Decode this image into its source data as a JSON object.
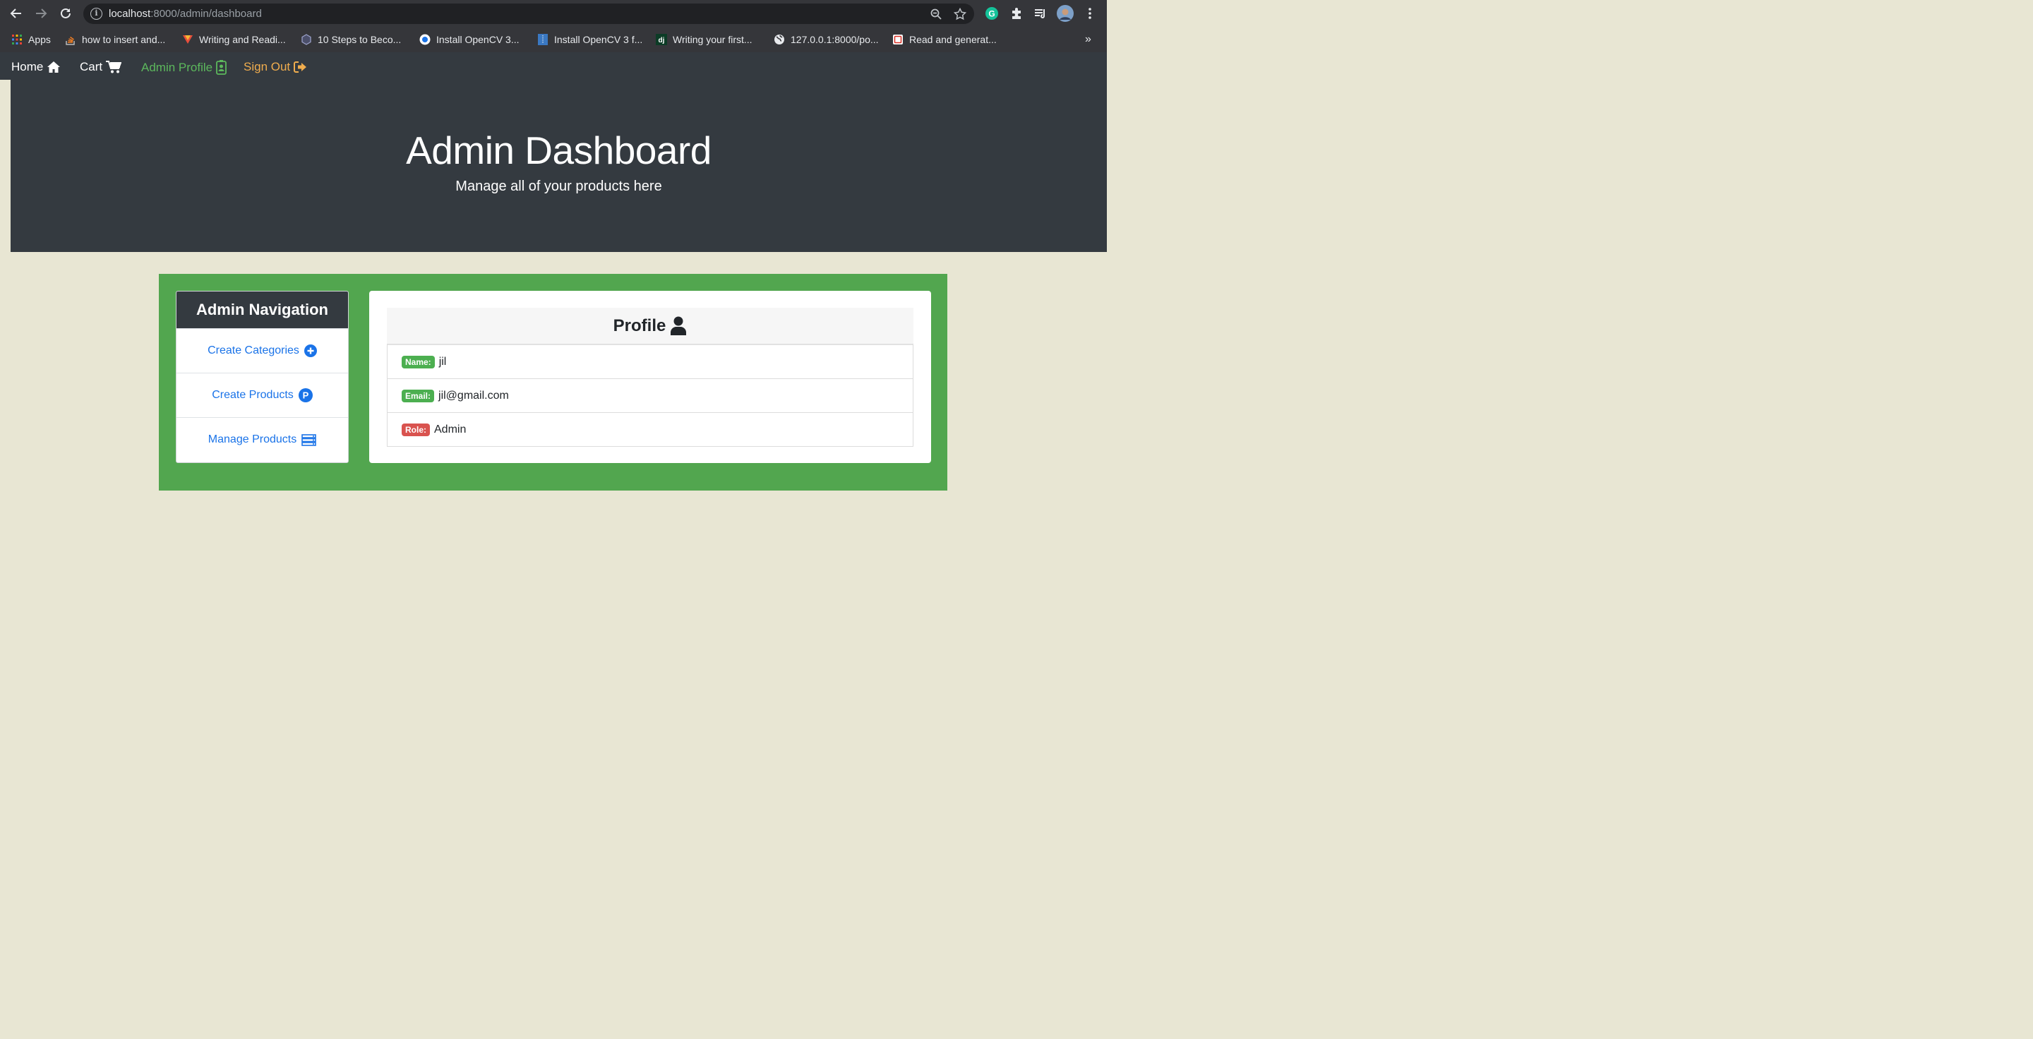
{
  "browser": {
    "url_host": "localhost",
    "url_rest": ":8000/admin/dashboard",
    "bookmarks": [
      {
        "label": "Apps"
      },
      {
        "label": "how to insert and..."
      },
      {
        "label": "Writing and Readi..."
      },
      {
        "label": "10 Steps to Beco..."
      },
      {
        "label": "Install OpenCV 3..."
      },
      {
        "label": "Install OpenCV 3 f..."
      },
      {
        "label": "Writing your first..."
      },
      {
        "label": "127.0.0.1:8000/po..."
      },
      {
        "label": "Read and generat..."
      }
    ],
    "overflow_label": "»"
  },
  "navbar": {
    "home": "Home",
    "cart": "Cart",
    "admin_profile": "Admin Profile",
    "sign_out": "Sign Out",
    "colors": {
      "admin_profile": "#5cb85c",
      "sign_out": "#f0ad4e"
    }
  },
  "jumbotron": {
    "title": "Admin Dashboard",
    "subtitle": "Manage all of your products here"
  },
  "admin_nav": {
    "title": "Admin Navigation",
    "items": [
      {
        "label": "Create Categories",
        "icon": "plus-circle-icon"
      },
      {
        "label": "Create Products",
        "icon": "parking-circle-icon"
      },
      {
        "label": "Manage Products",
        "icon": "server-icon"
      }
    ]
  },
  "profile": {
    "title": "Profile",
    "rows": [
      {
        "badge": "Name:",
        "value": "jil",
        "badge_color": "#4caf50"
      },
      {
        "badge": "Email:",
        "value": "jil@gmail.com",
        "badge_color": "#4caf50"
      },
      {
        "badge": "Role:",
        "value": "Admin",
        "badge_color": "#d9534f"
      }
    ]
  }
}
